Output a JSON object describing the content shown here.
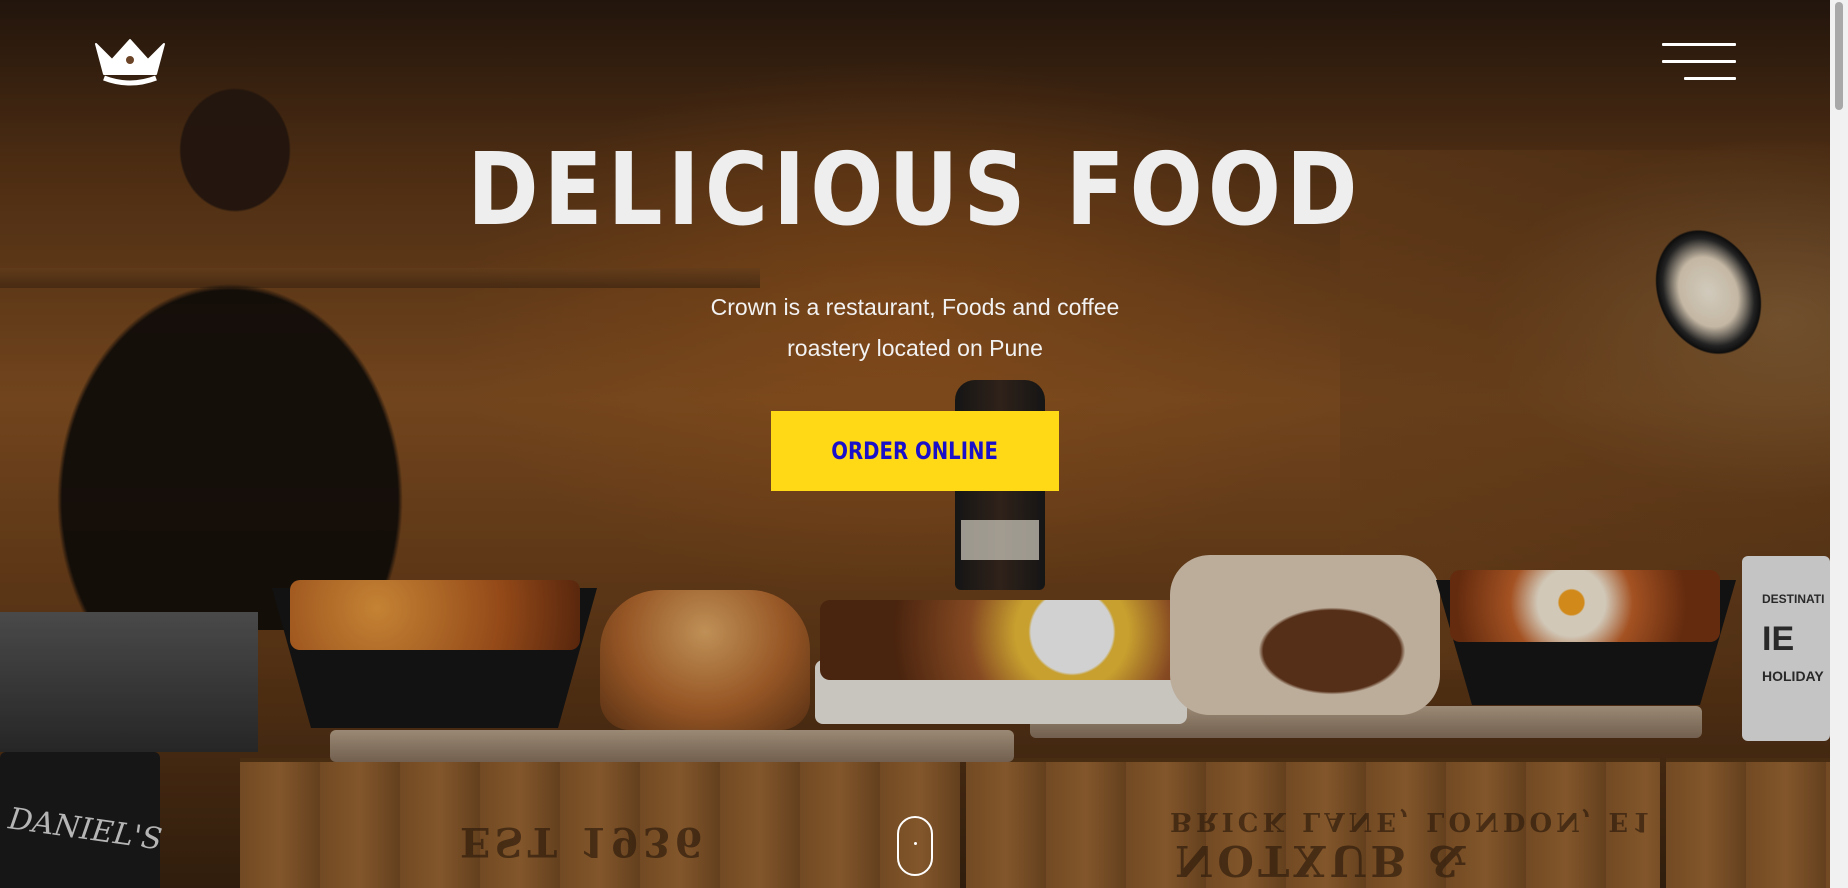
{
  "nav": {
    "logo_icon": "crown-icon",
    "menu_icon": "hamburger-menu-icon"
  },
  "hero": {
    "headline": "DELICIOUS FOOD",
    "subtitle_line1": "Crown is a restaurant, Foods and coffee",
    "subtitle_line2": "roastery located on Pune",
    "cta_label": "ORDER ONLINE",
    "scroll_icon": "mouse-scroll-icon"
  },
  "colors": {
    "cta_bg": "#ffd915",
    "cta_text": "#1a10c9",
    "headline": "#eeeeee"
  }
}
